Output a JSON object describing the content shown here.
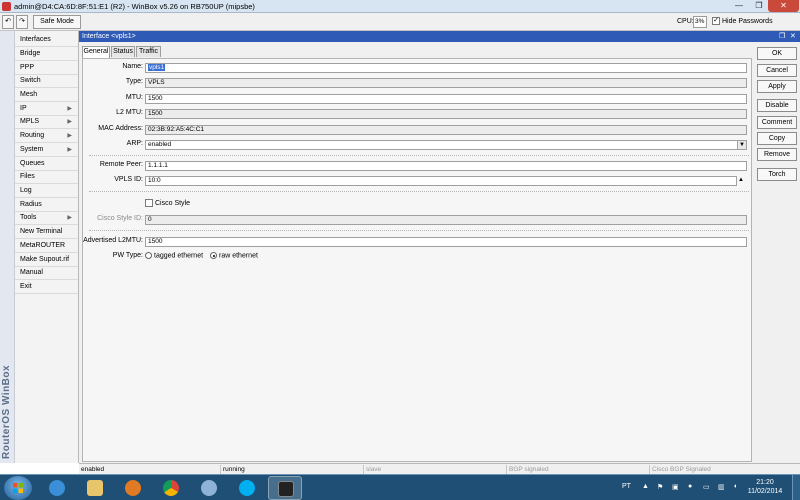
{
  "titlebar": {
    "title": "admin@D4:CA:6D:8F:51:E1 (R2) - WinBox v5.26 on RB750UP (mipsbe)",
    "minimize": "—",
    "maximize": "❐",
    "close": "✕"
  },
  "toolbar": {
    "undo": "↶",
    "redo": "↷",
    "safe_mode": "Safe Mode",
    "cpu_label": "CPU:",
    "cpu_value": "3%",
    "hide_passwords": "Hide Passwords",
    "hide_passwords_checked": "✓"
  },
  "brand": "RouterOS WinBox",
  "sidebar": {
    "items": [
      {
        "label": "Interfaces",
        "arrow": ""
      },
      {
        "label": "Bridge",
        "arrow": ""
      },
      {
        "label": "PPP",
        "arrow": ""
      },
      {
        "label": "Switch",
        "arrow": ""
      },
      {
        "label": "Mesh",
        "arrow": ""
      },
      {
        "label": "IP",
        "arrow": "▶"
      },
      {
        "label": "MPLS",
        "arrow": "▶"
      },
      {
        "label": "Routing",
        "arrow": "▶"
      },
      {
        "label": "System",
        "arrow": "▶"
      },
      {
        "label": "Queues",
        "arrow": ""
      },
      {
        "label": "Files",
        "arrow": ""
      },
      {
        "label": "Log",
        "arrow": ""
      },
      {
        "label": "Radius",
        "arrow": ""
      },
      {
        "label": "Tools",
        "arrow": "▶"
      },
      {
        "label": "New Terminal",
        "arrow": ""
      },
      {
        "label": "MetaROUTER",
        "arrow": ""
      },
      {
        "label": "Make Supout.rif",
        "arrow": ""
      },
      {
        "label": "Manual",
        "arrow": ""
      },
      {
        "label": "Exit",
        "arrow": ""
      }
    ]
  },
  "window": {
    "title": "Interface <vpls1>",
    "tabs": [
      {
        "label": "General"
      },
      {
        "label": "Status"
      },
      {
        "label": "Traffic"
      }
    ]
  },
  "form": {
    "name_label": "Name:",
    "name_value": "vpls1",
    "type_label": "Type:",
    "type_value": "VPLS",
    "mtu_label": "MTU:",
    "mtu_value": "1500",
    "l2mtu_label": "L2 MTU:",
    "l2mtu_value": "1500",
    "mac_label": "MAC Address:",
    "mac_value": "02:3B:92:A5:4C:C1",
    "arp_label": "ARP:",
    "arp_value": "enabled",
    "remote_peer_label": "Remote Peer:",
    "remote_peer_value": "1.1.1.1",
    "vpls_id_label": "VPLS ID:",
    "vpls_id_value": "10:0",
    "cisco_style_label": "Cisco Style",
    "cisco_style_id_label": "Cisco Style ID:",
    "cisco_style_id_value": "0",
    "adv_l2mtu_label": "Advertised L2MTU:",
    "adv_l2mtu_value": "1500",
    "pw_type_label": "PW Type:",
    "pw_type_options": [
      "tagged ethernet",
      "raw ethernet"
    ]
  },
  "buttons": {
    "ok": "OK",
    "cancel": "Cancel",
    "apply": "Apply",
    "disable": "Disable",
    "comment": "Comment",
    "copy": "Copy",
    "remove": "Remove",
    "torch": "Torch"
  },
  "statusbar": {
    "state": "enabled",
    "running": "running",
    "slave": "slave",
    "bgp": "BGP signaled",
    "cisco_bgp": "Cisco BGP Signaled"
  },
  "taskbar": {
    "language": "PT",
    "time": "21:20",
    "date": "11/02/2014"
  }
}
